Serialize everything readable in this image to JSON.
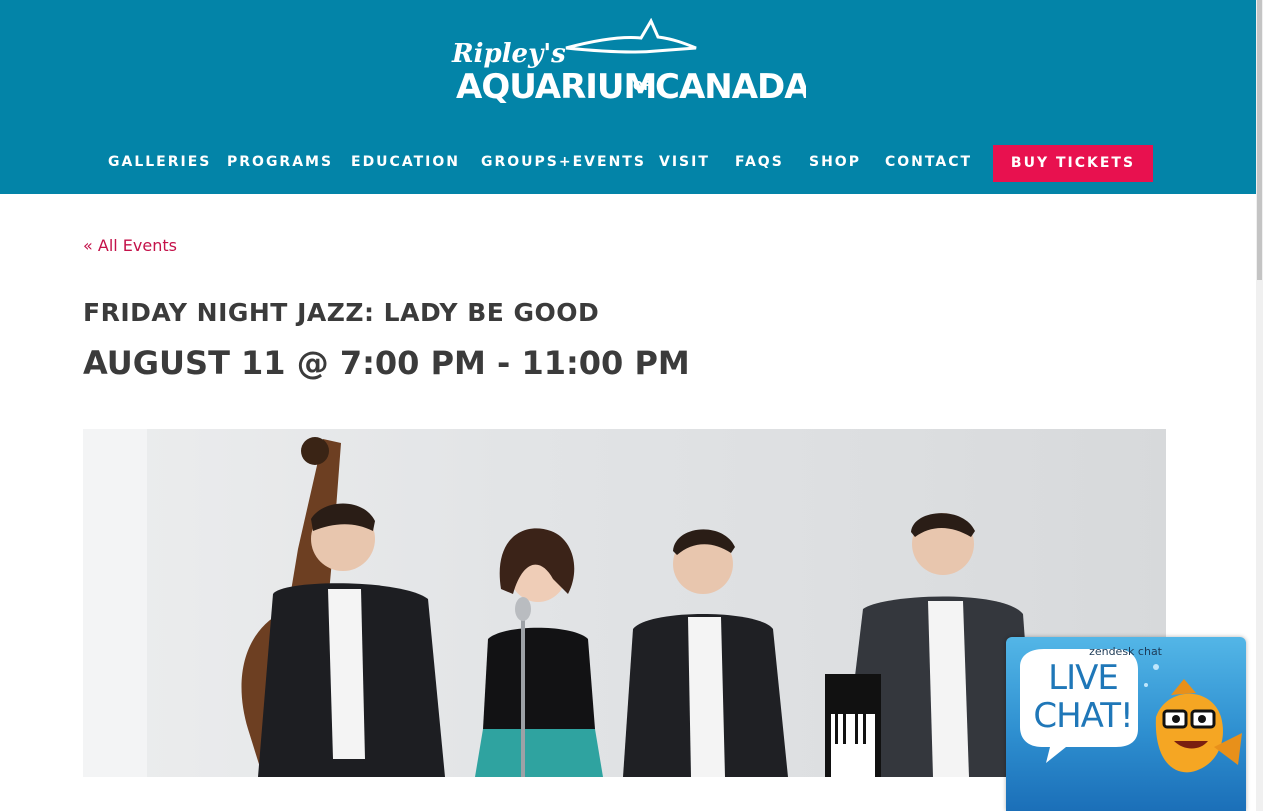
{
  "header": {
    "logo": {
      "line1": "Ripley's",
      "line2_a": "AQUARIUM",
      "line2_of": "OF",
      "line2_b": "CANADA"
    },
    "nav": [
      {
        "label": "GALLERIES"
      },
      {
        "label": "PROGRAMS"
      },
      {
        "label": "EDUCATION"
      },
      {
        "label": "GROUPS+EVENTS"
      },
      {
        "label": "VISIT"
      },
      {
        "label": "FAQS"
      },
      {
        "label": "SHOP"
      },
      {
        "label": "CONTACT"
      }
    ],
    "cta_label": "BUY TICKETS"
  },
  "content": {
    "back_link": "« All Events",
    "event_title": "FRIDAY NIGHT JAZZ: LADY BE GOOD",
    "event_datetime": "AUGUST 11 @ 7:00 PM - 11:00 PM"
  },
  "chat_widget": {
    "brand": "zendesk chat",
    "line1": "LIVE",
    "line2": "CHAT!"
  },
  "colors": {
    "header_bg": "#0384a8",
    "cta_bg": "#e8114f",
    "link": "#c4124a",
    "heading": "#3b3b3b"
  }
}
